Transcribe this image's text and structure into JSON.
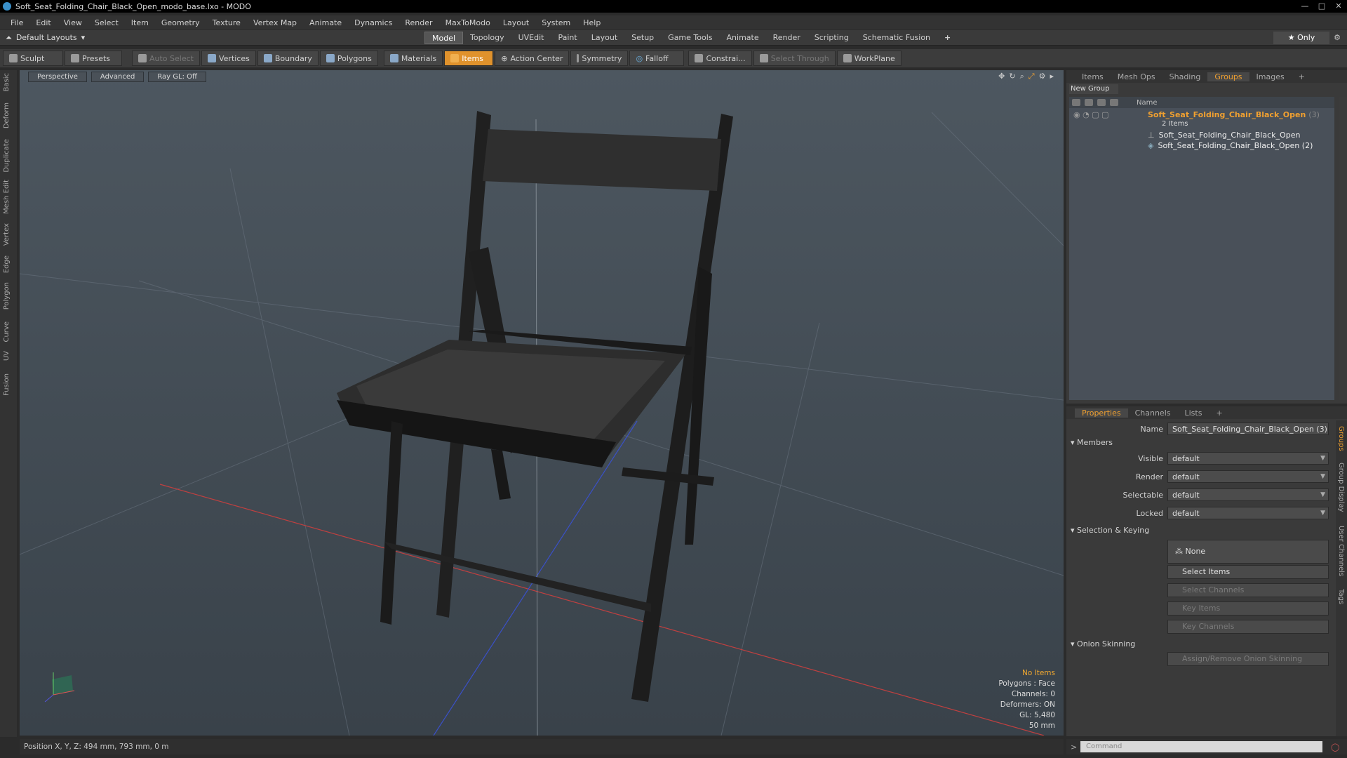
{
  "window": {
    "title": "Soft_Seat_Folding_Chair_Black_Open_modo_base.lxo - MODO"
  },
  "menu": [
    "File",
    "Edit",
    "View",
    "Select",
    "Item",
    "Geometry",
    "Texture",
    "Vertex Map",
    "Animate",
    "Dynamics",
    "Render",
    "MaxToModo",
    "Layout",
    "System",
    "Help"
  ],
  "layouts": {
    "current": "Default Layouts",
    "tabs": [
      "Model",
      "Topology",
      "UVEdit",
      "Paint",
      "Layout",
      "Setup",
      "Game Tools",
      "Animate",
      "Render",
      "Scripting",
      "Schematic Fusion"
    ],
    "active": "Model",
    "only_label": "Only"
  },
  "toolbar": {
    "sculpt": "Sculpt",
    "presets": "Presets",
    "auto_select": "Auto Select",
    "vertices": "Vertices",
    "boundary": "Boundary",
    "polygons": "Polygons",
    "materials": "Materials",
    "items": "Items",
    "action_center": "Action Center",
    "symmetry": "Symmetry",
    "falloff": "Falloff",
    "constrain": "Constrai...",
    "select_through": "Select Through",
    "workplane": "WorkPlane"
  },
  "left_tabs": [
    "Basic",
    "Deform",
    "Duplicate",
    "Mesh Edit",
    "Vertex",
    "Edge",
    "Polygon",
    "Curve",
    "UV",
    "Fusion"
  ],
  "viewport": {
    "view": "Perspective",
    "shading": "Advanced",
    "raygl": "Ray GL: Off",
    "stats": {
      "selection": "No Items",
      "polygons": "Polygons : Face",
      "channels": "Channels: 0",
      "deformers": "Deformers: ON",
      "gl": "GL: 5,480",
      "focal": "50 mm"
    }
  },
  "status": {
    "position": "Position X, Y, Z:  494 mm, 793 mm, 0 m"
  },
  "groups_panel": {
    "tabs": [
      "Items",
      "Mesh Ops",
      "Shading",
      "Groups",
      "Images"
    ],
    "active": "Groups",
    "new_group": "New Group",
    "col_name": "Name",
    "group_name": "Soft_Seat_Folding_Chair_Black_Open",
    "group_count": "(3)",
    "group_items": "2 Items",
    "children": [
      "Soft_Seat_Folding_Chair_Black_Open",
      "Soft_Seat_Folding_Chair_Black_Open (2)"
    ]
  },
  "properties": {
    "tabs": [
      "Properties",
      "Channels",
      "Lists"
    ],
    "active": "Properties",
    "name_label": "Name",
    "name_value": "Soft_Seat_Folding_Chair_Black_Open (3)",
    "members": "Members",
    "visible_label": "Visible",
    "visible": "default",
    "render_label": "Render",
    "render": "default",
    "selectable_label": "Selectable",
    "selectable": "default",
    "locked_label": "Locked",
    "locked": "default",
    "sel_keying": "Selection & Keying",
    "none": "None",
    "select_items": "Select Items",
    "select_channels": "Select Channels",
    "key_items": "Key Items",
    "key_channels": "Key Channels",
    "onion": "Onion Skinning",
    "onion_btn": "Assign/Remove Onion Skinning",
    "side_tabs": [
      "Groups",
      "Group Display",
      "User Channels",
      "Tags"
    ]
  },
  "command": {
    "placeholder": "Command"
  }
}
